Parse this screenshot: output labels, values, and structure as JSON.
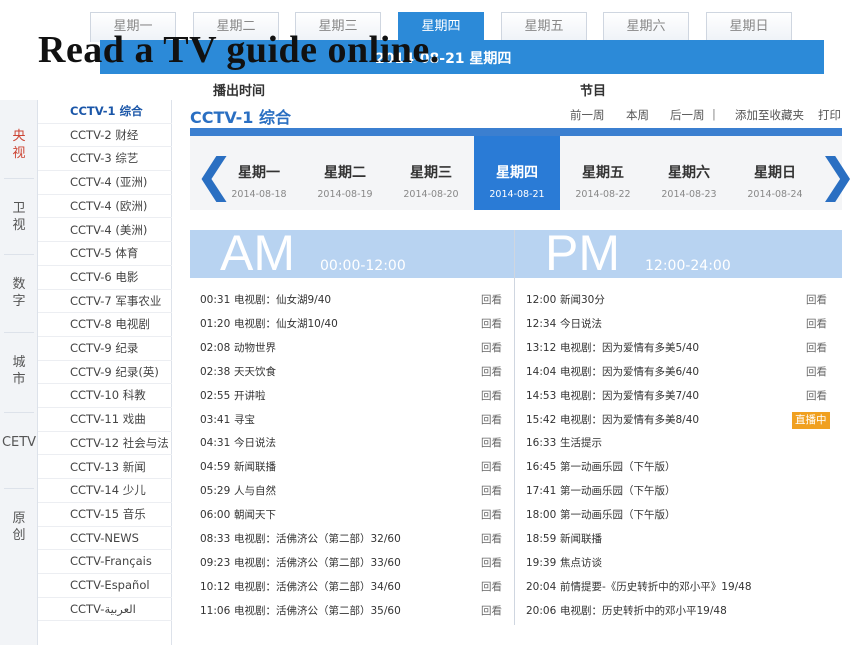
{
  "top_tabs": [
    "星期一",
    "星期二",
    "星期三",
    "星期四",
    "星期五",
    "星期六",
    "星期日"
  ],
  "top_active_index": 3,
  "strip_date": "2014-08-21 星期四",
  "overlay_title": "Read a TV guide online.",
  "column_heads": {
    "time": "播出时间",
    "program": "节目"
  },
  "categories": [
    "央视",
    "卫视",
    "数字",
    "城市",
    "CETV",
    "原创"
  ],
  "channels": [
    "CCTV-1 综合",
    "CCTV-2 财经",
    "CCTV-3 综艺",
    "CCTV-4 (亚洲)",
    "CCTV-4 (欧洲)",
    "CCTV-4 (美洲)",
    "CCTV-5 体育",
    "CCTV-6 电影",
    "CCTV-7 军事农业",
    "CCTV-8 电视剧",
    "CCTV-9 纪录",
    "CCTV-9 纪录(英)",
    "CCTV-10 科教",
    "CCTV-11 戏曲",
    "CCTV-12 社会与法",
    "CCTV-13 新闻",
    "CCTV-14 少儿",
    "CCTV-15 音乐",
    "CCTV-NEWS",
    "CCTV-Français",
    "CCTV-Español",
    "CCTV-العربية"
  ],
  "panel": {
    "title": "CCTV-1 综合",
    "prev_week": "前一周",
    "this_week": "本周",
    "next_week": "后一周",
    "separator": "|",
    "add_fav": "添加至收藏夹",
    "print": "打印"
  },
  "days": [
    {
      "name": "星期一",
      "date": "2014-08-18"
    },
    {
      "name": "星期二",
      "date": "2014-08-19"
    },
    {
      "name": "星期三",
      "date": "2014-08-20"
    },
    {
      "name": "星期四",
      "date": "2014-08-21"
    },
    {
      "name": "星期五",
      "date": "2014-08-22"
    },
    {
      "name": "星期六",
      "date": "2014-08-23"
    },
    {
      "name": "星期日",
      "date": "2014-08-24"
    }
  ],
  "arrows": {
    "left": "❮",
    "right": "❯"
  },
  "am": {
    "label": "AM",
    "range": "00:00-12:00"
  },
  "pm": {
    "label": "PM",
    "range": "12:00-24:00"
  },
  "am_programs": [
    {
      "time": "00:31",
      "title": "电视剧：仙女湖9/40",
      "action": "回看"
    },
    {
      "time": "01:20",
      "title": "电视剧：仙女湖10/40",
      "action": "回看"
    },
    {
      "time": "02:08",
      "title": "动物世界",
      "action": "回看"
    },
    {
      "time": "02:38",
      "title": "天天饮食",
      "action": "回看"
    },
    {
      "time": "02:55",
      "title": "开讲啦",
      "action": "回看"
    },
    {
      "time": "03:41",
      "title": "寻宝",
      "action": "回看"
    },
    {
      "time": "04:31",
      "title": "今日说法",
      "action": "回看"
    },
    {
      "time": "04:59",
      "title": "新闻联播",
      "action": "回看"
    },
    {
      "time": "05:29",
      "title": "人与自然",
      "action": "回看"
    },
    {
      "time": "06:00",
      "title": "朝闻天下",
      "action": "回看"
    },
    {
      "time": "08:33",
      "title": "电视剧：活佛济公（第二部）32/60",
      "action": "回看"
    },
    {
      "time": "09:23",
      "title": "电视剧：活佛济公（第二部）33/60",
      "action": "回看"
    },
    {
      "time": "10:12",
      "title": "电视剧：活佛济公（第二部）34/60",
      "action": "回看"
    },
    {
      "time": "11:06",
      "title": "电视剧：活佛济公（第二部）35/60",
      "action": "回看"
    }
  ],
  "pm_programs": [
    {
      "time": "12:00",
      "title": "新闻30分",
      "action": "回看"
    },
    {
      "time": "12:34",
      "title": "今日说法",
      "action": "回看"
    },
    {
      "time": "13:12",
      "title": "电视剧：因为爱情有多美5/40",
      "action": "回看"
    },
    {
      "time": "14:04",
      "title": "电视剧：因为爱情有多美6/40",
      "action": "回看"
    },
    {
      "time": "14:53",
      "title": "电视剧：因为爱情有多美7/40",
      "action": "回看"
    },
    {
      "time": "15:42",
      "title": "电视剧：因为爱情有多美8/40",
      "action": "直播中"
    },
    {
      "time": "16:33",
      "title": "生活提示",
      "action": ""
    },
    {
      "time": "16:45",
      "title": "第一动画乐园（下午版）",
      "action": ""
    },
    {
      "time": "17:41",
      "title": "第一动画乐园（下午版）",
      "action": ""
    },
    {
      "time": "18:00",
      "title": "第一动画乐园（下午版）",
      "action": ""
    },
    {
      "time": "18:59",
      "title": "新闻联播",
      "action": ""
    },
    {
      "time": "19:39",
      "title": "焦点访谈",
      "action": ""
    },
    {
      "time": "20:04",
      "title": "前情提要-《历史转折中的邓小平》19/48",
      "action": ""
    },
    {
      "time": "20:06",
      "title": "电视剧：历史转折中的邓小平19/48",
      "action": ""
    }
  ],
  "colors": {
    "accent": "#2a7bd6",
    "live": "#f0a020",
    "header_light": "#b8d3f1"
  }
}
